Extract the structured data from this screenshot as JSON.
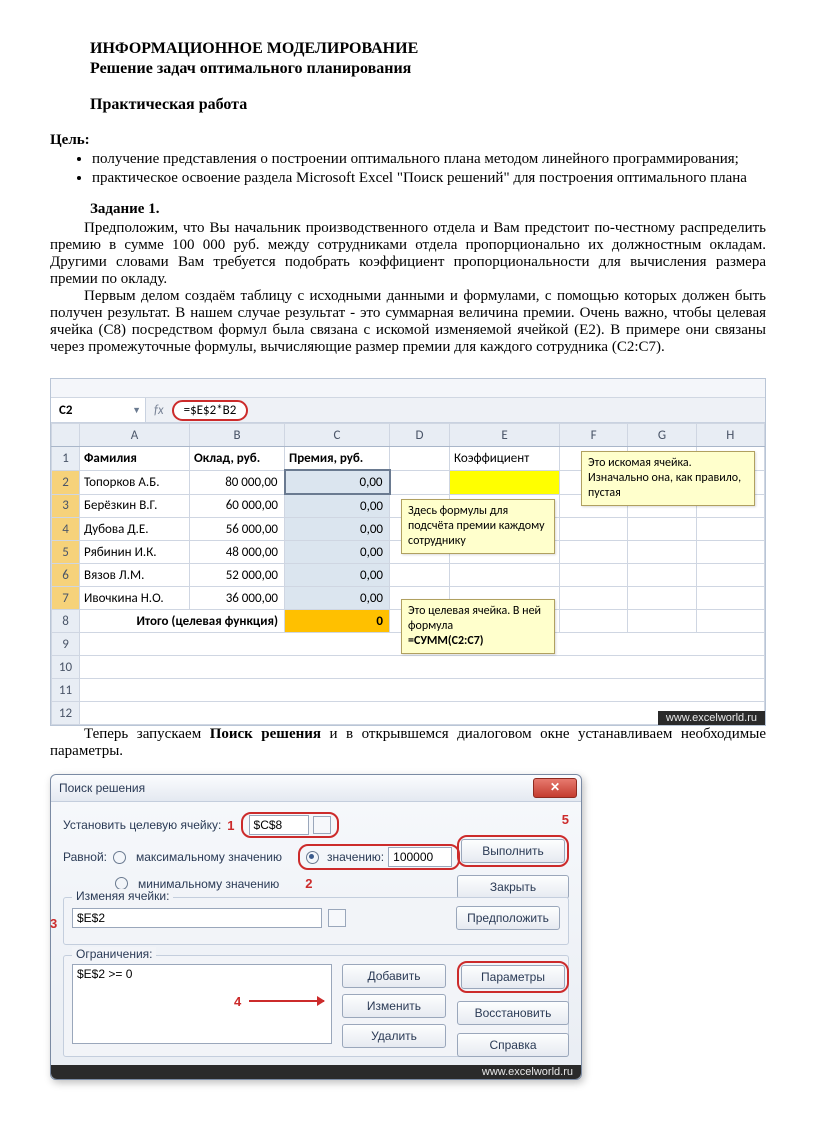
{
  "doc": {
    "title1": "ИНФОРМАЦИОННОЕ МОДЕЛИРОВАНИЕ",
    "title2": "Решение задач оптимального планирования",
    "subtitle": "Практическая работа",
    "goal_label": "Цель:",
    "goals": [
      "получение представления о построении оптимального плана методом линейного программирования;",
      "практическое освоение раздела Microsoft Excel  \"Поиск решений\" для построения оптимального плана"
    ],
    "task_label": "Задание 1.",
    "p1": "Предположим, что Вы начальник производственного отдела и Вам предстоит по-честному распределить премию в сумме 100 000 руб. между сотрудниками отдела пропорционально их должностным окладам. Другими словами Вам требуется подобрать коэффициент пропорциональности для вычисления размера премии по окладу.",
    "p2": "Первым делом создаём таблицу с исходными данными и формулами, с помощью которых должен быть получен результат. В нашем случае результат - это суммарная величина премии. Очень важно, чтобы целевая ячейка (С8) посредством формул была связана с искомой изменяемой ячейкой (Е2). В примере они связаны через промежуточные формулы, вычисляющие размер премии для каждого сотрудника (С2:С7).",
    "p3a": "Теперь запускаем ",
    "p3b": "Поиск решения",
    "p3c": " и в открывшемся диалоговом окне устанавливаем необходимые параметры."
  },
  "excel": {
    "namebox": "C2",
    "formula": "=$E$2*B2",
    "cols": [
      "A",
      "B",
      "C",
      "D",
      "E",
      "F",
      "G",
      "H"
    ],
    "headers": {
      "A": "Фамилия",
      "B": "Оклад, руб.",
      "C": "Премия, руб.",
      "E": "Коэффициент"
    },
    "rows": [
      {
        "n": "Топорков А.Б.",
        "s": "80 000,00",
        "p": "0,00"
      },
      {
        "n": "Берёзкин В.Г.",
        "s": "60 000,00",
        "p": "0,00"
      },
      {
        "n": "Дубова Д.Е.",
        "s": "56 000,00",
        "p": "0,00"
      },
      {
        "n": "Рябинин И.К.",
        "s": "48 000,00",
        "p": "0,00"
      },
      {
        "n": "Вязов Л.М.",
        "s": "52 000,00",
        "p": "0,00"
      },
      {
        "n": "Ивочкина Н.О.",
        "s": "36 000,00",
        "p": "0,00"
      }
    ],
    "total_label": "Итого (целевая функция)",
    "total_value": "0",
    "note1": "Здесь формулы для подсчёта премии каждому сотруднику",
    "note2": "Это искомая ячейка. Изначально она, как правило, пустая",
    "note3a": "Это целевая ячейка. В ней формула",
    "note3b": "=СУММ(C2:C7)",
    "watermark": "www.excelworld.ru"
  },
  "solver": {
    "title": "Поиск решения",
    "set_target": "Установить целевую ячейку:",
    "target_val": "$C$8",
    "equal": "Равной:",
    "opt_max": "максимальному значению",
    "opt_val": "значению:",
    "opt_val_num": "100000",
    "opt_min": "минимальному значению",
    "changing": "Изменяя ячейки:",
    "changing_val": "$E$2",
    "guess": "Предположить",
    "constraints": "Ограничения:",
    "constraint1": "$E$2 >= 0",
    "add": "Добавить",
    "edit": "Изменить",
    "del": "Удалить",
    "run": "Выполнить",
    "close": "Закрыть",
    "params": "Параметры",
    "restore": "Восстановить",
    "help": "Справка",
    "nums": {
      "n1": "1",
      "n2": "2",
      "n3": "3",
      "n4": "4",
      "n5": "5"
    },
    "watermark": "www.excelworld.ru"
  }
}
